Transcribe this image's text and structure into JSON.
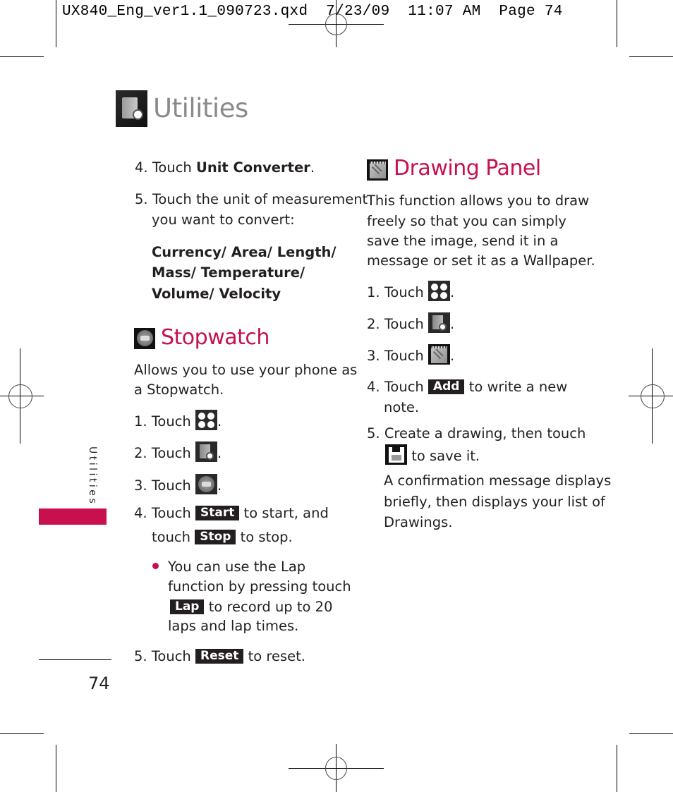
{
  "slug": {
    "filename": "UX840_Eng_ver1.1_090723.qxd",
    "date": "7/23/09",
    "time": "11:07 AM",
    "page_label": "Page 74"
  },
  "header": {
    "title": "Utilities",
    "icon": "utilities-icon"
  },
  "side_tab": {
    "label": "Utilities",
    "accent_color": "#c8104f"
  },
  "page_number": "74",
  "left_column": {
    "step4": {
      "num": "4.",
      "prefix": "Touch ",
      "bold": "Unit Converter",
      "suffix": "."
    },
    "step5": {
      "num": "5.",
      "line1": "Touch the unit of measurement",
      "line2": "you want to convert:"
    },
    "units": {
      "line1": "Currency/ Area/ Length/",
      "line2": "Mass/ Temperature/",
      "line3": "Volume/ Velocity"
    },
    "stopwatch": {
      "title": "Stopwatch",
      "icon": "stopwatch-icon",
      "desc_line1": "Allows you to use your phone as",
      "desc_line2": "a Stopwatch.",
      "steps": [
        {
          "num": "1.",
          "text": "Touch",
          "icon": "menu-grid-icon",
          "suffix": "."
        },
        {
          "num": "2.",
          "text": "Touch",
          "icon": "utilities-icon",
          "suffix": "."
        },
        {
          "num": "3.",
          "text": "Touch",
          "icon": "stopwatch-icon",
          "suffix": "."
        }
      ],
      "step4": {
        "num": "4.",
        "prefix": "Touch",
        "button": "Start",
        "suffix": "to start, and",
        "line2_prefix": "touch",
        "line2_button": "Stop",
        "line2_suffix": "to stop."
      },
      "bullet": {
        "line1": "You can use the Lap",
        "line2": "function by pressing touch",
        "button": "Lap",
        "line3_suffix": "to record up to 20",
        "line4": "laps and lap times."
      },
      "step5": {
        "num": "5.",
        "prefix": "Touch",
        "button": "Reset",
        "suffix": "to reset."
      }
    }
  },
  "right_column": {
    "drawing_panel": {
      "title": "Drawing Panel",
      "icon": "drawing-panel-icon",
      "desc_line1": "This function allows you to draw",
      "desc_line2": "freely so that you can simply",
      "desc_line3": "save the image, send it in a",
      "desc_line4": "message or set it as a Wallpaper.",
      "steps": [
        {
          "num": "1.",
          "text": "Touch",
          "icon": "menu-grid-icon",
          "suffix": "."
        },
        {
          "num": "2.",
          "text": "Touch",
          "icon": "utilities-icon",
          "suffix": "."
        },
        {
          "num": "3.",
          "text": "Touch",
          "icon": "drawing-panel-icon",
          "suffix": "."
        }
      ],
      "step4": {
        "num": "4.",
        "prefix": "Touch",
        "button": "Add",
        "suffix": "to write a new",
        "line2": "note."
      },
      "step5": {
        "num": "5.",
        "line1": "Create a drawing, then touch",
        "icon": "save-icon",
        "line2_suffix": "to save it."
      },
      "note_line1": "A confirmation message displays",
      "note_line2": "briefly, then displays your list of",
      "note_line3": "Drawings."
    }
  }
}
